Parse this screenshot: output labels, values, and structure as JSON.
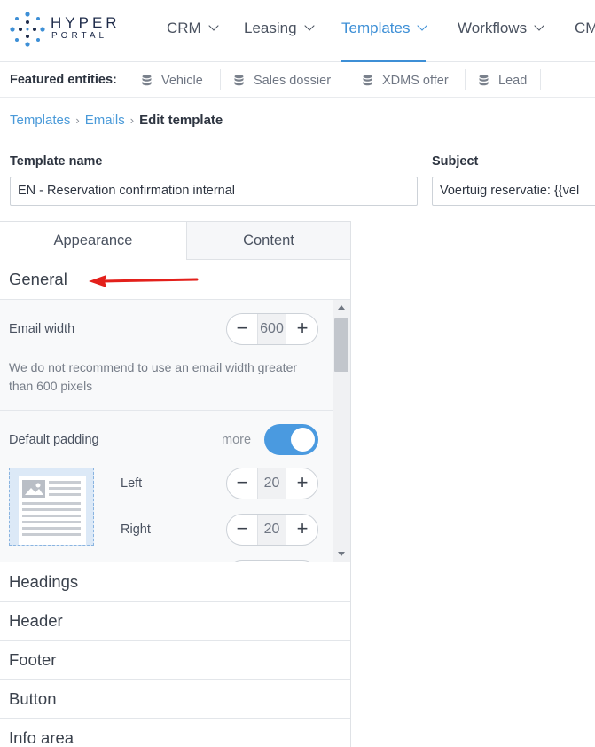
{
  "app": {
    "brand": "HYPER",
    "brand_sub": "PORTAL",
    "accent_color": "#3d8fd6"
  },
  "nav": {
    "items": [
      {
        "label": "CRM",
        "active": false
      },
      {
        "label": "Leasing",
        "active": false
      },
      {
        "label": "Templates",
        "active": true
      },
      {
        "label": "Workflows",
        "active": false
      },
      {
        "label": "CM",
        "active": false
      }
    ]
  },
  "featured": {
    "label": "Featured entities:",
    "items": [
      {
        "label": "Vehicle",
        "icon": "database-icon"
      },
      {
        "label": "Sales dossier",
        "icon": "database-icon"
      },
      {
        "label": "XDMS offer",
        "icon": "database-icon"
      },
      {
        "label": "Lead",
        "icon": "database-icon"
      }
    ]
  },
  "breadcrumb": {
    "items": [
      "Templates",
      "Emails"
    ],
    "current": "Edit template",
    "separator": "›"
  },
  "form": {
    "template_name_label": "Template name",
    "template_name_value": "EN - Reservation confirmation internal",
    "subject_label": "Subject",
    "subject_value": "Voertuig reservatie: {{vel"
  },
  "panel": {
    "tabs": [
      "Appearance",
      "Content"
    ],
    "active_tab": "Appearance",
    "general": {
      "title": "General",
      "email_width_label": "Email width",
      "email_width_value": "600",
      "hint": "We do not recommend to use an email width greater than 600 pixels",
      "default_padding_label": "Default padding",
      "more_label": "more",
      "toggle_on": true,
      "left_label": "Left",
      "left_value": "20",
      "right_label": "Right",
      "right_value": "20",
      "minus": "−",
      "plus": "+"
    },
    "sections": [
      "Headings",
      "Header",
      "Footer",
      "Button",
      "Info area"
    ]
  }
}
